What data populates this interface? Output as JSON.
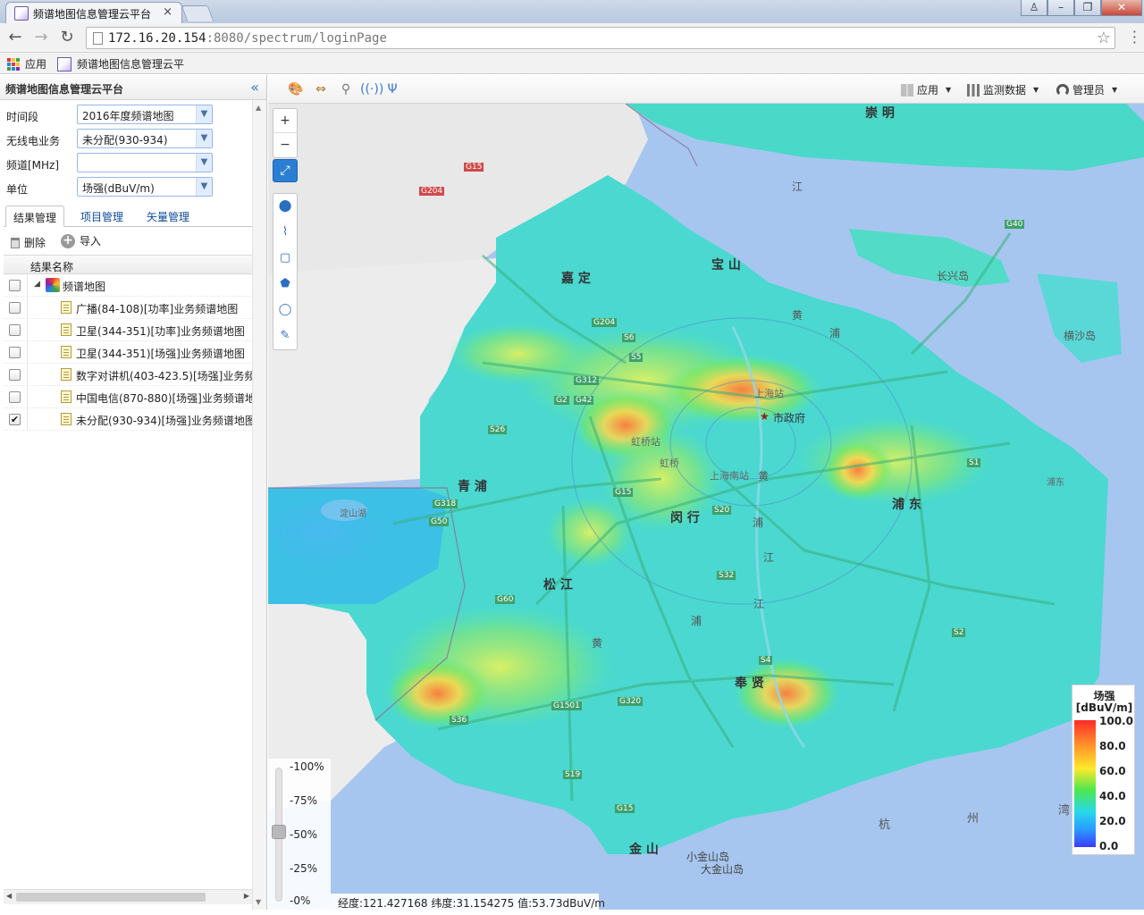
{
  "browser": {
    "tab_title": "频谱地图信息管理云平台",
    "tab_close": "×",
    "url_host": "172.16.20.154",
    "url_rest": ":8080/spectrum/loginPage",
    "window_buttons": {
      "user": "♙",
      "minimize": "–",
      "restore": "❐",
      "close": "✕"
    },
    "bookmarks": {
      "apps": "应用",
      "site": "频谱地图信息管理云平"
    }
  },
  "app": {
    "panel_title": "频谱地图信息管理云平台",
    "collapse": "«",
    "filters": [
      {
        "label": "时间段",
        "value": "2016年度频谱地图"
      },
      {
        "label": "无线电业务",
        "value": "未分配(930-934)"
      },
      {
        "label": "频道[MHz]",
        "value": ""
      },
      {
        "label": "单位",
        "value": "场强(dBuV/m)"
      }
    ],
    "tabs": [
      "结果管理",
      "项目管理",
      "矢量管理"
    ],
    "actions": {
      "delete": "删除",
      "import": "导入"
    },
    "grid_header": "结果名称",
    "tree": {
      "root": {
        "label": "频谱地图",
        "checked": false
      },
      "items": [
        {
          "label": "广播(84-108)[功率]业务频谱地图",
          "checked": false
        },
        {
          "label": "卫星(344-351)[功率]业务频谱地图",
          "checked": false
        },
        {
          "label": "卫星(344-351)[场强]业务频谱地图",
          "checked": false
        },
        {
          "label": "数字对讲机(403-423.5)[场强]业务频谱",
          "checked": false
        },
        {
          "label": "中国电信(870-880)[场强]业务频谱地",
          "checked": false
        },
        {
          "label": "未分配(930-934)[场强]业务频谱地图",
          "checked": true
        }
      ]
    },
    "top_menus": {
      "apps": "应用",
      "monitor": "监测数据",
      "admin": "管理员"
    }
  },
  "map": {
    "zoom_in": "+",
    "zoom_out": "−",
    "opacity_ticks": [
      "-100%",
      "-75%",
      "-50%",
      "-25%",
      "-0%"
    ],
    "opacity_value": 0.5,
    "coord_readout": "经度:121.427168 纬度:31.154275 值:53.73dBuV/m",
    "legend": {
      "title_line1": "场强",
      "title_line2": "[dBuV/m]",
      "values": [
        "100.0",
        "80.0",
        "60.0",
        "40.0",
        "20.0",
        "0.0"
      ],
      "colors": [
        "#ff2a2a",
        "#ffe92a",
        "#4ee84e",
        "#27d9e9",
        "#3b3bff"
      ]
    },
    "labels": {
      "chongming": "崇 明",
      "jiang_top": "江",
      "changxing": "长兴岛",
      "hengsha": "横沙岛",
      "jiading": "嘉 定",
      "baoshan": "宝 山",
      "qingpu": "青 浦",
      "songjiang": "松 江",
      "minhang": "闵 行",
      "pudong": "浦 东",
      "fengxian": "奉 贤",
      "jinshan": "金 山",
      "huang1": "黄",
      "pu1": "浦",
      "huang2": "黄",
      "pu2": "浦",
      "jiang2": "江",
      "huang3": "黄",
      "pu3": "浦",
      "jiang3": "江",
      "hang": "杭",
      "zhou": "州",
      "wan": "湾",
      "xiaojinshan": "小金山岛",
      "dajinshan": "大金山岛",
      "shanghai_station": "上海站",
      "city_gov": "市政府",
      "hongqiao_station": "虹桥站",
      "hongqiao": "虹桥",
      "shanghai_south": "上海南站",
      "pudong_airport": "浦东",
      "dianshan_lake": "淀山湖"
    },
    "roads": {
      "g15a": "G15",
      "g204a": "G204",
      "g40": "G40",
      "g204b": "G204",
      "s6": "S6",
      "s5": "S5",
      "g312": "G312",
      "g2": "G2",
      "g42": "G42",
      "s26": "S26",
      "g15b": "G15",
      "g318": "G318",
      "g50": "G50",
      "s20": "S20",
      "s32a": "S32",
      "g60": "G60",
      "g1501": "G1501",
      "g320": "G320",
      "s36": "S36",
      "s4": "S4",
      "s2": "S2",
      "s1": "S1",
      "s19": "S19",
      "g15c": "G15"
    }
  }
}
